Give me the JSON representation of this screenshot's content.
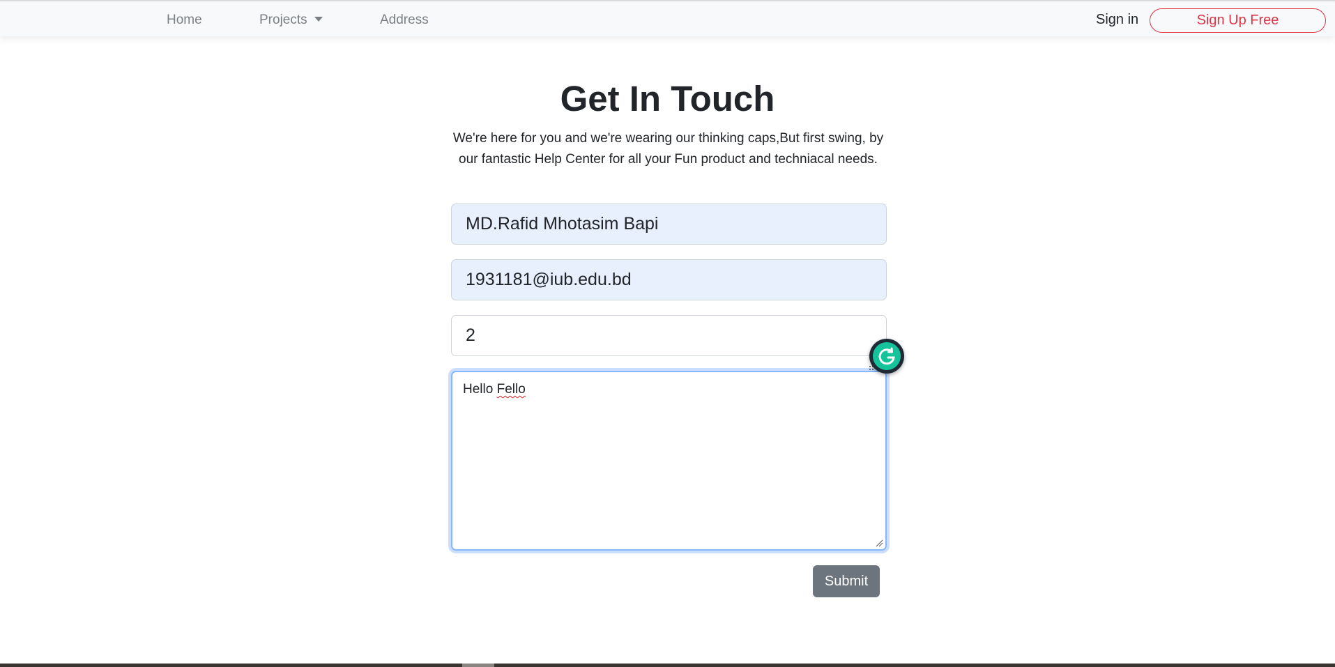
{
  "nav": {
    "home": "Home",
    "projects": "Projects",
    "address": "Address",
    "sign_in": "Sign in",
    "sign_up": "Sign Up Free"
  },
  "contact": {
    "title": "Get In Touch",
    "subtitle": "We're here for you and we're wearing our thinking caps,But first swing, by our fantastic Help Center for all your Fun product and techniacal needs.",
    "name_value": "MD.Rafid Mhotasim Bapi",
    "email_value": "1931181@iub.edu.bd",
    "number_value": "2",
    "message_word1": "Hello",
    "message_word2": "Fello",
    "submit": "Submit"
  },
  "colors": {
    "accent_red": "#dc3545",
    "submit_gray": "#6c757d",
    "autofill_blue": "#e8f0fe",
    "focus_blue": "#86b7fe",
    "grammarly_green": "#15c39a"
  },
  "icons": {
    "projects_dropdown": "caret-down-icon",
    "grammarly": "grammarly-icon",
    "resize": "resize-handle-icon"
  }
}
